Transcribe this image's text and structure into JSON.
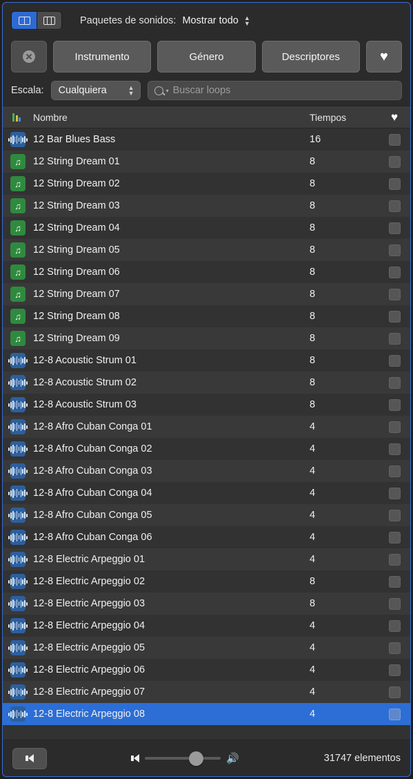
{
  "window": {
    "accent": "#2c6ed5"
  },
  "topbar": {
    "view_toggle": [
      {
        "name": "list-view",
        "icon": "columns-wide-icon",
        "active": true
      },
      {
        "name": "grid-view",
        "icon": "columns-narrow-icon",
        "active": false
      }
    ],
    "packs_label": "Paquetes de sonidos:",
    "packs_value": "Mostrar todo"
  },
  "filters": {
    "reset": {
      "icon": "clear-x-icon",
      "label": ""
    },
    "buttons": [
      {
        "label": "Instrumento",
        "name": "filter-instrumento"
      },
      {
        "label": "Género",
        "name": "filter-genero"
      },
      {
        "label": "Descriptores",
        "name": "filter-descriptores"
      }
    ],
    "favorite": {
      "icon": "heart-icon",
      "glyph": "♥"
    }
  },
  "search": {
    "scale_label": "Escala:",
    "scale_value": "Cualquiera",
    "placeholder": "Buscar loops",
    "value": ""
  },
  "table": {
    "headers": {
      "icon": "",
      "name": "Nombre",
      "beats": "Tiempos",
      "favorite": "♥"
    },
    "rows": [
      {
        "icon": "audio",
        "name": "12 Bar Blues Bass",
        "beats": "16",
        "selected": false
      },
      {
        "icon": "midi",
        "name": "12 String Dream 01",
        "beats": "8",
        "selected": false
      },
      {
        "icon": "midi",
        "name": "12 String Dream 02",
        "beats": "8",
        "selected": false
      },
      {
        "icon": "midi",
        "name": "12 String Dream 03",
        "beats": "8",
        "selected": false
      },
      {
        "icon": "midi",
        "name": "12 String Dream 04",
        "beats": "8",
        "selected": false
      },
      {
        "icon": "midi",
        "name": "12 String Dream 05",
        "beats": "8",
        "selected": false
      },
      {
        "icon": "midi",
        "name": "12 String Dream 06",
        "beats": "8",
        "selected": false
      },
      {
        "icon": "midi",
        "name": "12 String Dream 07",
        "beats": "8",
        "selected": false
      },
      {
        "icon": "midi",
        "name": "12 String Dream 08",
        "beats": "8",
        "selected": false
      },
      {
        "icon": "midi",
        "name": "12 String Dream 09",
        "beats": "8",
        "selected": false
      },
      {
        "icon": "audio",
        "name": "12-8 Acoustic Strum 01",
        "beats": "8",
        "selected": false
      },
      {
        "icon": "audio",
        "name": "12-8 Acoustic Strum 02",
        "beats": "8",
        "selected": false
      },
      {
        "icon": "audio",
        "name": "12-8 Acoustic Strum 03",
        "beats": "8",
        "selected": false
      },
      {
        "icon": "audio",
        "name": "12-8 Afro Cuban Conga 01",
        "beats": "4",
        "selected": false
      },
      {
        "icon": "audio",
        "name": "12-8 Afro Cuban Conga 02",
        "beats": "4",
        "selected": false
      },
      {
        "icon": "audio",
        "name": "12-8 Afro Cuban Conga 03",
        "beats": "4",
        "selected": false
      },
      {
        "icon": "audio",
        "name": "12-8 Afro Cuban Conga 04",
        "beats": "4",
        "selected": false
      },
      {
        "icon": "audio",
        "name": "12-8 Afro Cuban Conga 05",
        "beats": "4",
        "selected": false
      },
      {
        "icon": "audio",
        "name": "12-8 Afro Cuban Conga 06",
        "beats": "4",
        "selected": false
      },
      {
        "icon": "audio",
        "name": "12-8 Electric Arpeggio 01",
        "beats": "4",
        "selected": false
      },
      {
        "icon": "audio",
        "name": "12-8 Electric Arpeggio 02",
        "beats": "8",
        "selected": false
      },
      {
        "icon": "audio",
        "name": "12-8 Electric Arpeggio 03",
        "beats": "8",
        "selected": false
      },
      {
        "icon": "audio",
        "name": "12-8 Electric Arpeggio 04",
        "beats": "4",
        "selected": false
      },
      {
        "icon": "audio",
        "name": "12-8 Electric Arpeggio 05",
        "beats": "4",
        "selected": false
      },
      {
        "icon": "audio",
        "name": "12-8 Electric Arpeggio 06",
        "beats": "4",
        "selected": false
      },
      {
        "icon": "audio",
        "name": "12-8 Electric Arpeggio 07",
        "beats": "4",
        "selected": false
      },
      {
        "icon": "audio",
        "name": "12-8 Electric Arpeggio 08",
        "beats": "4",
        "selected": true
      }
    ]
  },
  "bottom": {
    "play_icon": "speaker-play-icon",
    "volume_low_icon": "speaker-low-icon",
    "volume_high_icon": "speaker-high-icon",
    "volume_percent": 58,
    "count": "31747 elementos"
  }
}
